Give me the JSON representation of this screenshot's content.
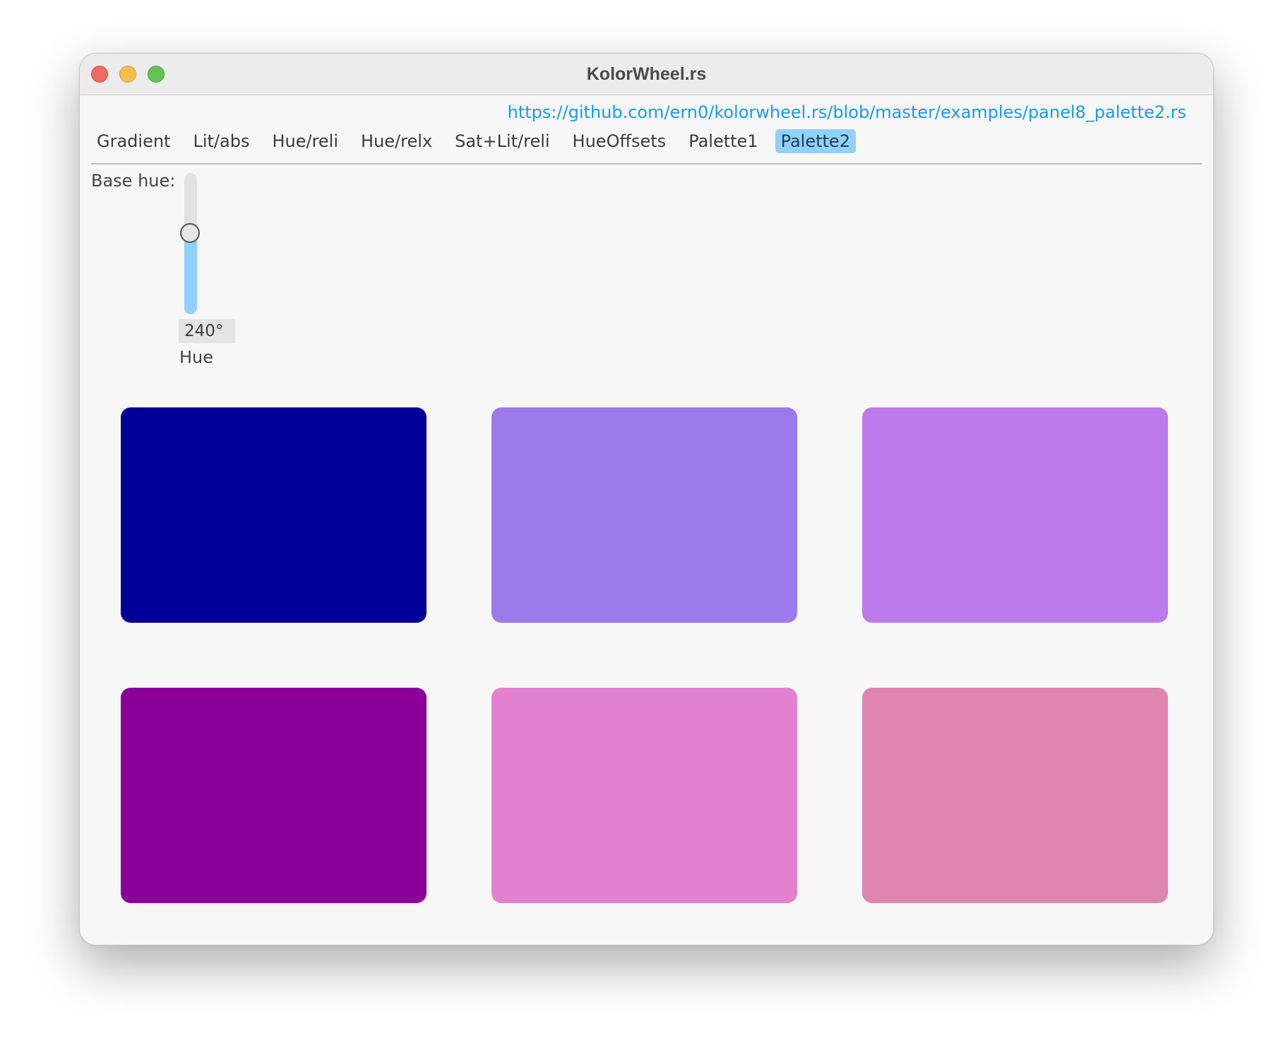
{
  "window": {
    "title": "KolorWheel.rs"
  },
  "header": {
    "source_link": "https://github.com/ern0/kolorwheel.rs/blob/master/examples/panel8_palette2.rs"
  },
  "tabs": [
    {
      "label": "Gradient",
      "active": false
    },
    {
      "label": "Lit/abs",
      "active": false
    },
    {
      "label": "Hue/reli",
      "active": false
    },
    {
      "label": "Hue/relx",
      "active": false
    },
    {
      "label": "Sat+Lit/reli",
      "active": false
    },
    {
      "label": "HueOffsets",
      "active": false
    },
    {
      "label": "Palette1",
      "active": false
    },
    {
      "label": "Palette2",
      "active": true
    }
  ],
  "controls": {
    "base_hue_label": "Base hue:",
    "hue_slider": {
      "value": 240,
      "min": 0,
      "max": 360,
      "value_text": "240°",
      "caption": "Hue"
    }
  },
  "colors": {
    "accent": "#90d1ff",
    "link": "#1a9be8"
  },
  "palette": [
    {
      "color": "#000099"
    },
    {
      "color": "#9c7aeb"
    },
    {
      "color": "#bd7aea"
    },
    {
      "color": "#8a0099"
    },
    {
      "color": "#e481cf"
    },
    {
      "color": "#e084b0"
    }
  ]
}
